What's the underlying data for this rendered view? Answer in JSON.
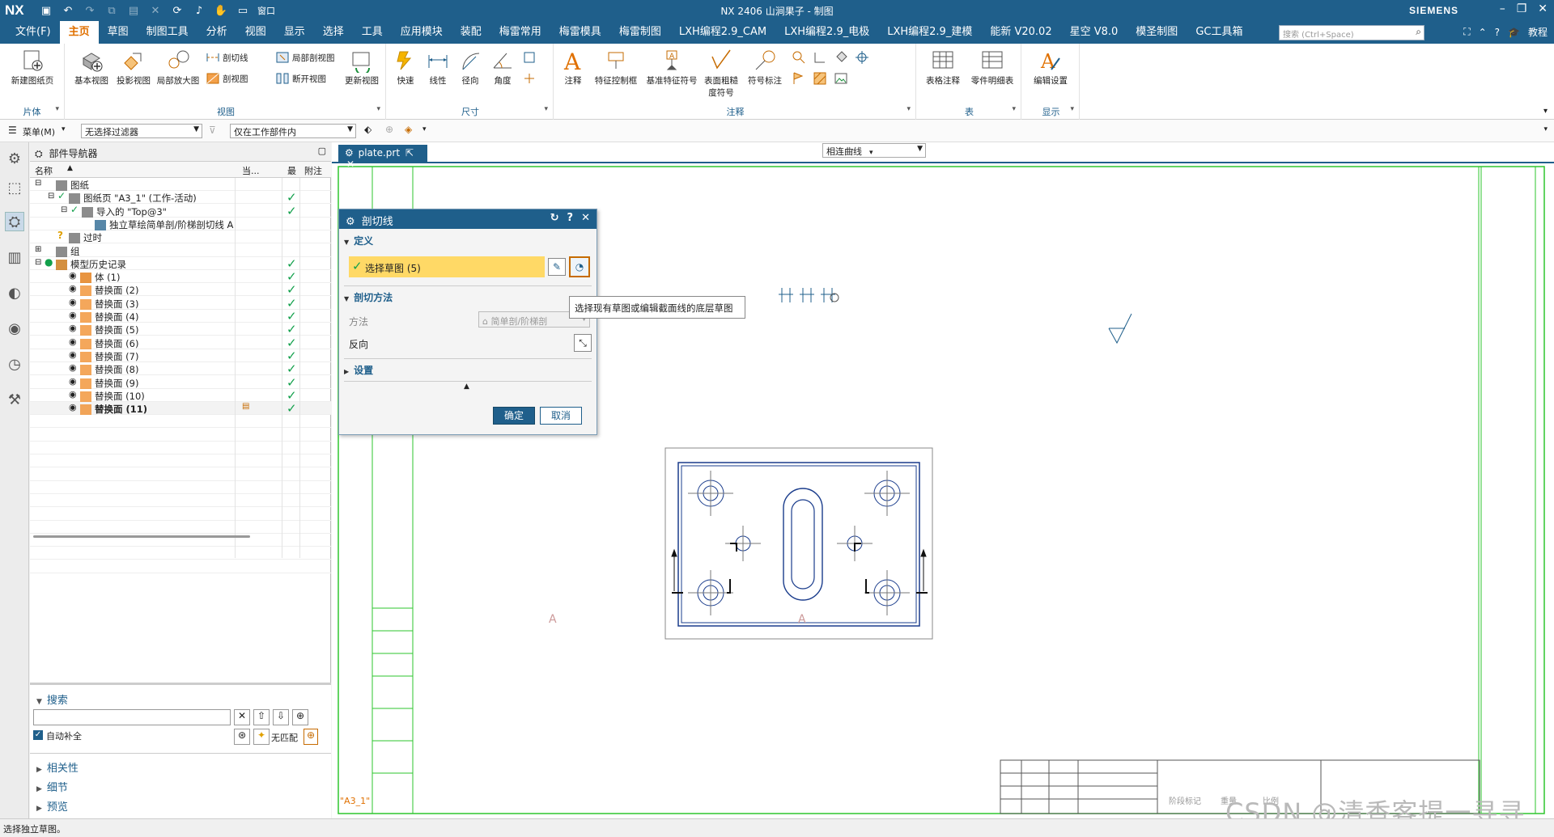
{
  "app": {
    "logo": "NX",
    "window_title": "NX 2406 山涧果子 - 制图",
    "brand": "SIEMENS",
    "window_menu": "窗口"
  },
  "menubar": {
    "tabs": [
      "文件(F)",
      "主页",
      "草图",
      "制图工具",
      "分析",
      "视图",
      "显示",
      "选择",
      "工具",
      "应用模块",
      "装配",
      "梅雷常用",
      "梅雷模具",
      "梅雷制图",
      "LXH编程2.9_CAM",
      "LXH编程2.9_电极",
      "LXH编程2.9_建模",
      "能新 V20.02",
      "星空 V8.0",
      "模圣制图",
      "GC工具箱"
    ],
    "active_tab": "主页",
    "search_placeholder": "搜索 (Ctrl+Space)",
    "tutorial": "教程"
  },
  "ribbon": {
    "groups": {
      "sheet": "片体",
      "view": "视图",
      "dimension": "尺寸",
      "annotation": "注释",
      "table": "表",
      "display": "显示"
    },
    "buttons": {
      "new_sheet": "新建图纸页",
      "base_view": "基本视图",
      "projected_view": "投影视图",
      "detail_view": "局部放大图",
      "section_line": "剖切线",
      "section_view": "剖视图",
      "break_out": "局部剖视图",
      "break_view": "断开视图",
      "update_view": "更新视图",
      "rapid": "快速",
      "linear": "线性",
      "radial": "径向",
      "angular": "角度",
      "note": "注释",
      "feature_control_frame": "特征控制框",
      "datum_feature": "基准特征符号",
      "surface_finish_1": "表面粗糙",
      "surface_finish_2": "度符号",
      "symbol_callout": "符号标注",
      "tabular_note": "表格注释",
      "parts_list": "零件明细表",
      "edit_settings": "编辑设置"
    }
  },
  "toolbar2": {
    "menu": "菜单(M)",
    "filter": "无选择过滤器",
    "scope": "仅在工作部件内"
  },
  "navigator": {
    "title": "部件导航器",
    "columns": {
      "name": "名称",
      "current": "当...",
      "latest": "最",
      "comment": "附注"
    },
    "rows": [
      {
        "label": "图纸",
        "indent": 0,
        "check": false,
        "expand": "-"
      },
      {
        "label": "图纸页 \"A3_1\" (工作-活动)",
        "indent": 1,
        "check": true,
        "expand": "-"
      },
      {
        "label": "导入的 \"Top@3\"",
        "indent": 2,
        "check": true,
        "expand": "-"
      },
      {
        "label": "独立草绘简单剖/阶梯剖切线 A",
        "indent": 3,
        "check": false,
        "expand": ""
      },
      {
        "label": "过时",
        "indent": 1,
        "check": false,
        "expand": ""
      },
      {
        "label": "组",
        "indent": 0,
        "check": false,
        "expand": "+"
      },
      {
        "label": "模型历史记录",
        "indent": 0,
        "check": true,
        "expand": "-"
      },
      {
        "label": "体 (1)",
        "indent": 1,
        "check": true,
        "expand": ""
      },
      {
        "label": "替换面 (2)",
        "indent": 1,
        "check": true,
        "expand": ""
      },
      {
        "label": "替换面 (3)",
        "indent": 1,
        "check": true,
        "expand": ""
      },
      {
        "label": "替换面 (4)",
        "indent": 1,
        "check": true,
        "expand": ""
      },
      {
        "label": "替换面 (5)",
        "indent": 1,
        "check": true,
        "expand": ""
      },
      {
        "label": "替换面 (6)",
        "indent": 1,
        "check": true,
        "expand": ""
      },
      {
        "label": "替换面 (7)",
        "indent": 1,
        "check": true,
        "expand": ""
      },
      {
        "label": "替换面 (8)",
        "indent": 1,
        "check": true,
        "expand": ""
      },
      {
        "label": "替换面 (9)",
        "indent": 1,
        "check": true,
        "expand": ""
      },
      {
        "label": "替换面 (10)",
        "indent": 1,
        "check": true,
        "expand": ""
      },
      {
        "label": "替换面 (11)",
        "indent": 1,
        "check": true,
        "expand": "",
        "bold": true
      }
    ],
    "search_section": "搜索",
    "auto_complete": "自动补全",
    "no_match": "无匹配",
    "sections": [
      "相关性",
      "细节",
      "预览"
    ]
  },
  "document": {
    "tab": "plate.prt",
    "sheet_name": "\"A3_1\"",
    "curve_rule": "相连曲线",
    "section_label": "A"
  },
  "dialog": {
    "title": "剖切线",
    "definition": "定义",
    "select_sketch": "选择草图 (5)",
    "section_method": "剖切方法",
    "method_label": "方法",
    "method_value": "简单剖/阶梯剖",
    "reverse_label": "反向",
    "settings": "设置",
    "ok": "确定",
    "cancel": "取消"
  },
  "tooltip": "选择现有草图或编辑截面线的底层草图",
  "title_block": {
    "cell_a": "重量",
    "cell_b": "比例",
    "cell_c": "阶段标记"
  },
  "status": "选择独立草图。",
  "watermark": "CSDN @清香客提一寻寻",
  "colors": {
    "nx_blue": "#1f5f8b",
    "active_tab": "#e07000",
    "border_green": "#2ec52e",
    "drawing_blue": "#1a3c8c",
    "highlight_yellow": "#ffd966"
  }
}
